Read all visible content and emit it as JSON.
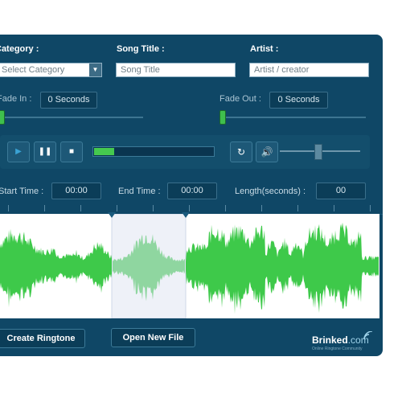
{
  "form": {
    "category_label": "Category :",
    "category_value": "Select Category",
    "song_title_label": "Song Title :",
    "song_title_placeholder": "Song Title",
    "artist_label": "Artist :",
    "artist_placeholder": "Artist / creator"
  },
  "fades": {
    "fade_in_label": "Fade In :",
    "fade_in_value": "0 Seconds",
    "fade_out_label": "Fade Out :",
    "fade_out_value": "0 Seconds"
  },
  "player": {
    "progress_fraction": 0.17,
    "volume_fraction": 0.47
  },
  "times": {
    "start_label": "Start Time :",
    "start_value": "00:00",
    "end_label": "End Time :",
    "end_value": "00:00",
    "length_label": "Length(seconds) :",
    "length_value": "00"
  },
  "footer": {
    "create_label": "Create Ringtone",
    "open_label": "Open New File",
    "logo_text": "Brinked",
    "logo_suffix": ".com",
    "logo_tagline": "Online Ringtone Community"
  },
  "colors": {
    "panel": "#0f4766",
    "waveform": "#3ec94a",
    "waveform_selected": "#8fd6a0",
    "selection": "#eef1f8"
  }
}
